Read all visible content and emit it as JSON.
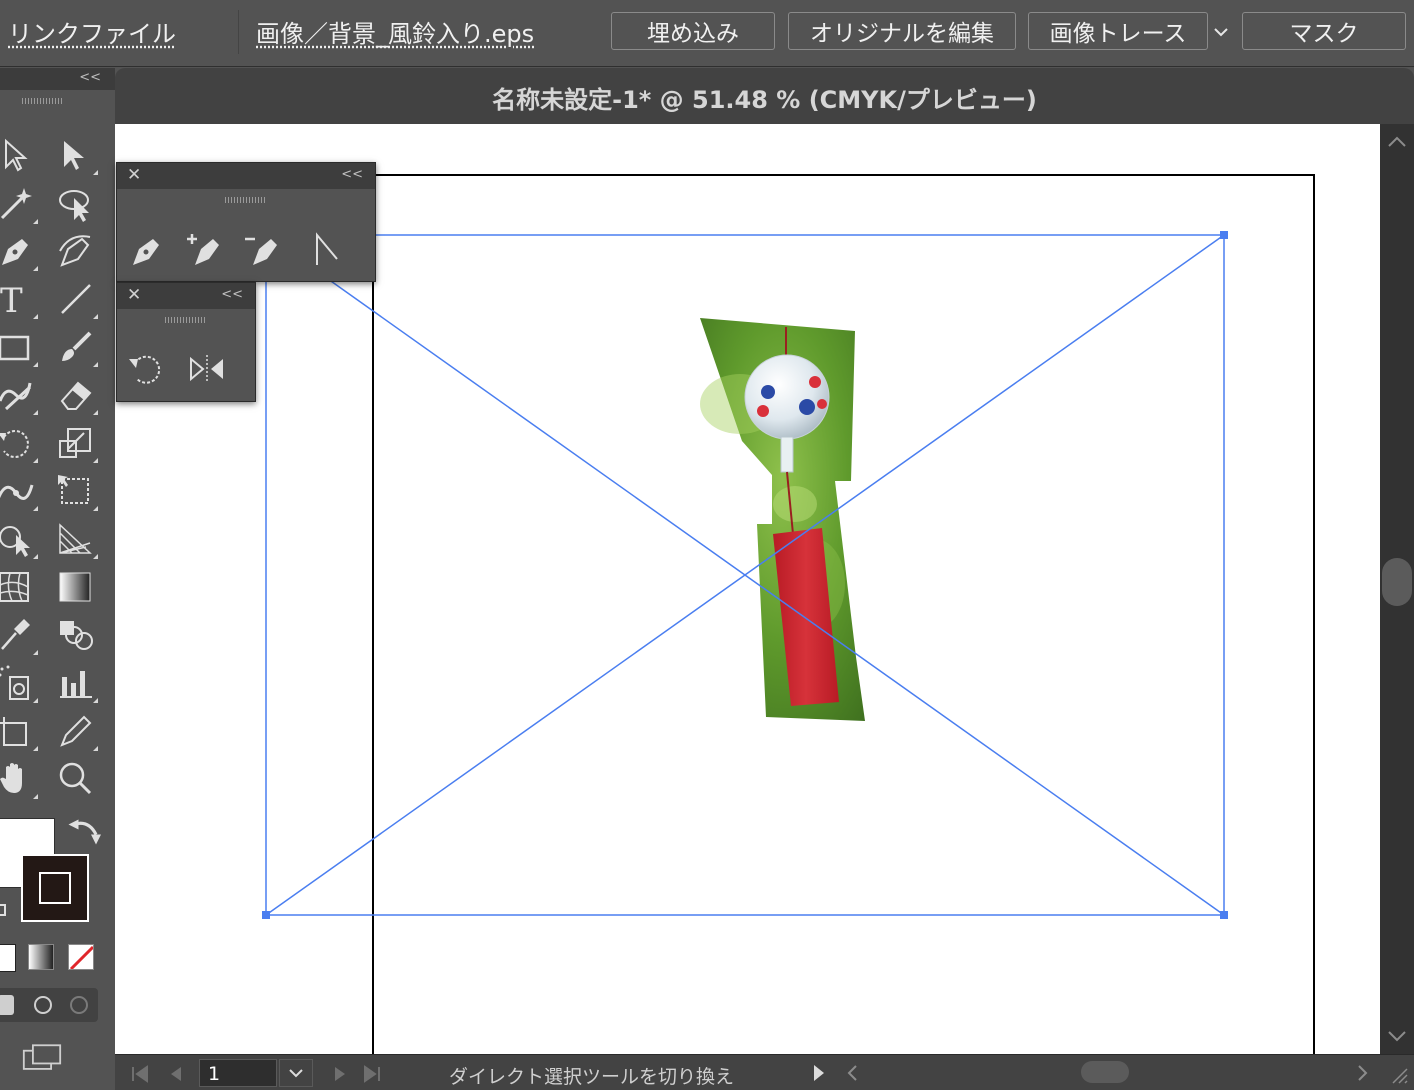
{
  "control_bar": {
    "linked_file_label": "リンクファイル",
    "file_name": "画像／背景_風鈴入り.eps",
    "buttons": {
      "embed": "埋め込み",
      "edit_original": "オリジナルを編集",
      "image_trace": "画像トレース",
      "mask": "マスク"
    }
  },
  "document": {
    "title": "名称未設定-1* @ 51.48 % (CMYK/プレビュー)",
    "zoom": "51.48 %",
    "color_mode": "CMYK/プレビュー"
  },
  "toolbar": {
    "collapse": "<<",
    "tools": [
      "selection-tool-icon",
      "direct-selection-tool-icon",
      "magic-wand-tool-icon",
      "lasso-tool-icon",
      "pen-tool-icon",
      "curvature-tool-icon",
      "type-tool-icon",
      "line-segment-tool-icon",
      "rectangle-tool-icon",
      "paintbrush-tool-icon",
      "shaper-tool-icon",
      "eraser-tool-icon",
      "rotate-tool-icon",
      "scale-tool-icon",
      "width-tool-icon",
      "free-transform-tool-icon",
      "shape-builder-tool-icon",
      "perspective-grid-tool-icon",
      "mesh-tool-icon",
      "gradient-tool-icon",
      "eyedropper-tool-icon",
      "blend-tool-icon",
      "symbol-sprayer-tool-icon",
      "column-graph-tool-icon",
      "artboard-tool-icon",
      "slice-tool-icon",
      "hand-tool-icon",
      "zoom-tool-icon"
    ]
  },
  "pen_panel": {
    "close": "✕",
    "collapse": "<<",
    "tools": [
      "pen-tool-icon",
      "add-anchor-point-tool-icon",
      "delete-anchor-point-tool-icon",
      "anchor-point-tool-icon"
    ]
  },
  "rotate_panel": {
    "close": "✕",
    "collapse": "<<",
    "tools": [
      "rotate-tool-icon",
      "reflect-tool-icon"
    ]
  },
  "status_bar": {
    "artboard_number": "1",
    "current_tool": "ダイレクト選択ツールを切り換え"
  },
  "colors": {
    "ui_bg": "#535353",
    "selection_blue": "#4a7ef0",
    "fill": "#ffffff",
    "stroke": "#231815",
    "none_slash": "#e0262b",
    "tanzaku_red": "#c8202a",
    "foliage_green": "#5f9a2c"
  }
}
